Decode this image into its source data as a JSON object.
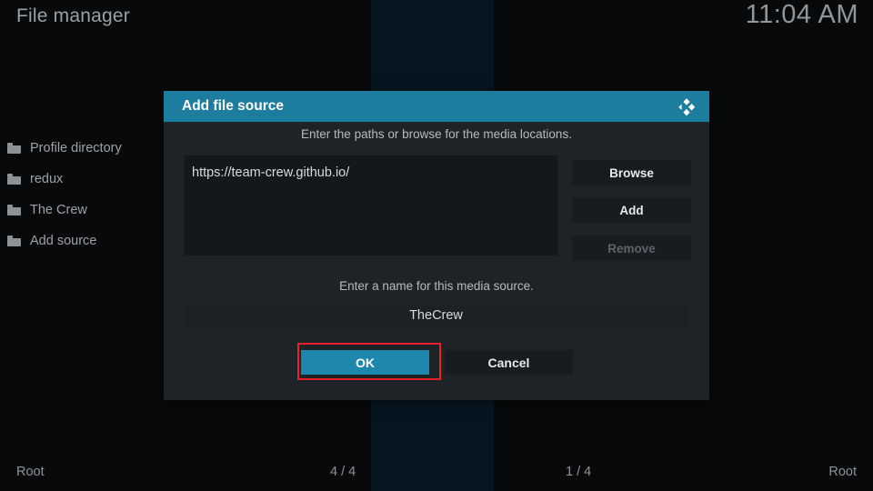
{
  "window": {
    "title": "File manager",
    "clock": "11:04 AM"
  },
  "sidebar": {
    "items": [
      {
        "label": "Profile directory",
        "icon": "folder-icon"
      },
      {
        "label": "redux",
        "icon": "folder-icon"
      },
      {
        "label": "The Crew",
        "icon": "folder-icon"
      },
      {
        "label": "Add source",
        "icon": "folder-icon"
      }
    ]
  },
  "status_bar": {
    "left_path": "Root",
    "left_count": "4 / 4",
    "right_count": "1 / 4",
    "right_path": "Root"
  },
  "dialog": {
    "title": "Add file source",
    "logo_icon": "kodi-logo-icon",
    "path_prompt": "Enter the paths or browse for the media locations.",
    "path_value": "https://team-crew.github.io/",
    "path_placeholder": "<None>",
    "buttons": {
      "browse": "Browse",
      "add": "Add",
      "remove": "Remove"
    },
    "name_prompt": "Enter a name for this media source.",
    "name_value": "TheCrew",
    "name_placeholder": "<None>",
    "ok": "OK",
    "cancel": "Cancel"
  },
  "colors": {
    "accent": "#1d7d9e",
    "focus_button": "#1d87ad",
    "highlight_box": "#e8202a",
    "dialog_bg": "#1d2327",
    "center_pane": "#061620"
  }
}
